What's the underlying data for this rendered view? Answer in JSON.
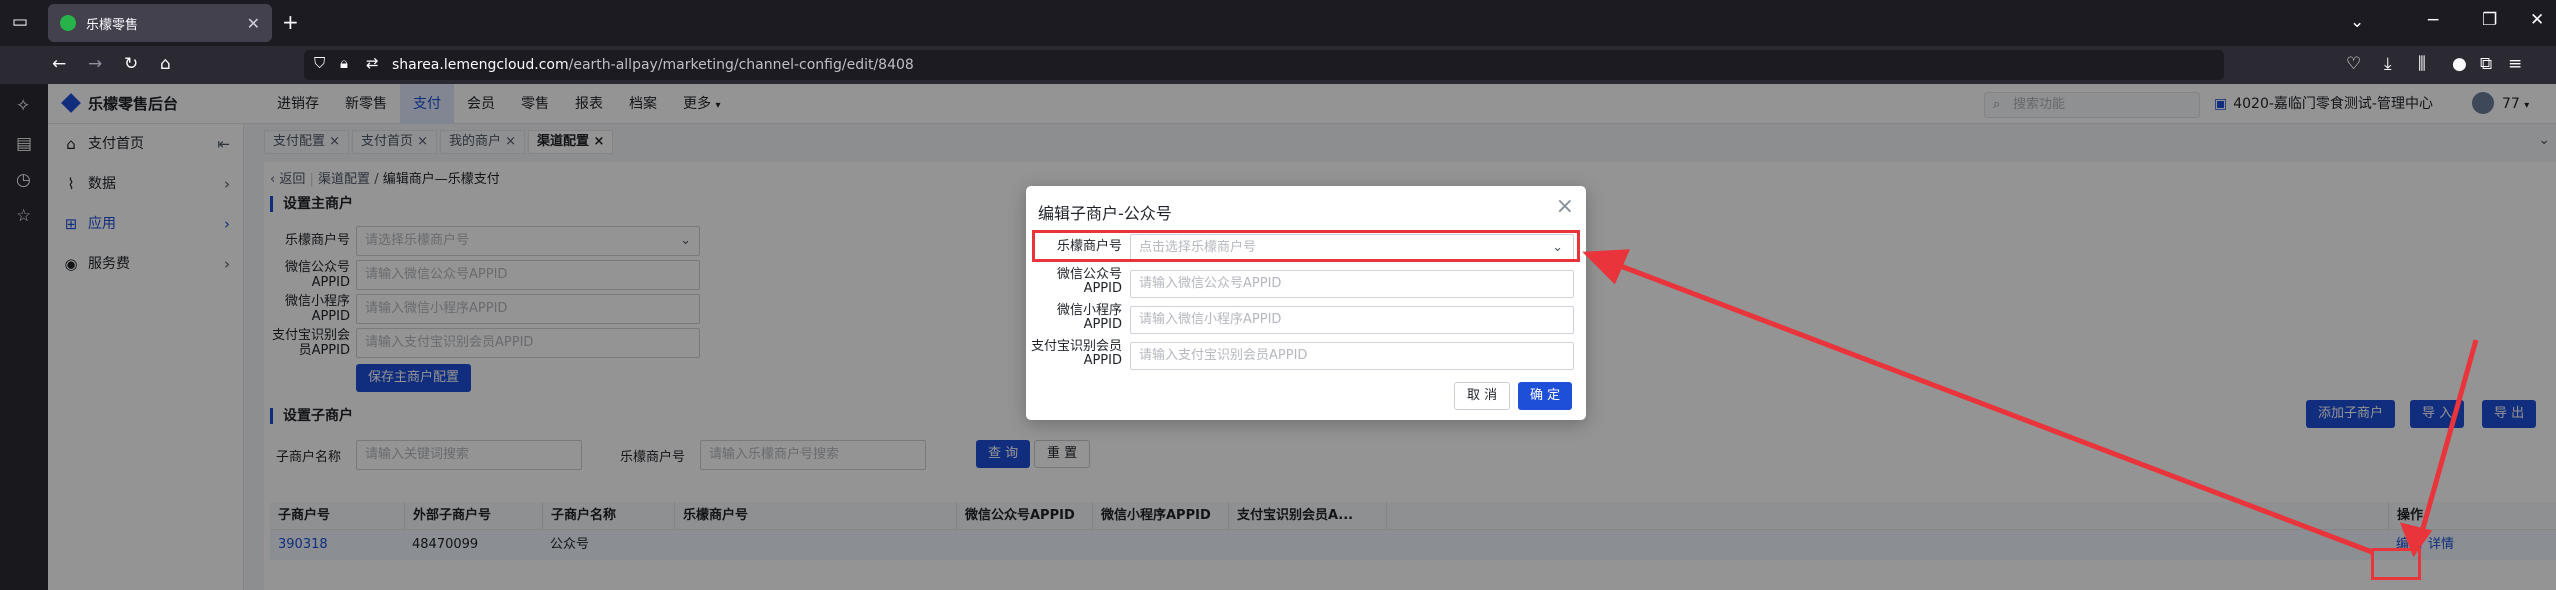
{
  "browser": {
    "tab_title": "乐檬零售",
    "url_host": "sharea.lemengcloud.com",
    "url_path": "/earth-allpay/marketing/channel-config/edit/8408"
  },
  "header": {
    "brand": "乐檬零售后台",
    "nav": [
      "进销存",
      "新零售",
      "支付",
      "会员",
      "零售",
      "报表",
      "档案",
      "更多"
    ],
    "active_nav": "支付",
    "search_placeholder": "搜索功能",
    "store": "4020-嘉临门零食测试-管理中心",
    "user": "77"
  },
  "sidebar": {
    "items": [
      {
        "label": "支付首页",
        "icon": "home-icon"
      },
      {
        "label": "数据",
        "icon": "chart-icon"
      },
      {
        "label": "应用",
        "icon": "apps-icon"
      },
      {
        "label": "服务费",
        "icon": "fee-icon"
      }
    ]
  },
  "page_tabs": [
    "支付配置",
    "支付首页",
    "我的商户",
    "渠道配置"
  ],
  "breadcrumb": {
    "back": "返回",
    "parent": "渠道配置",
    "current": "编辑商户—乐檬支付"
  },
  "main_merchant": {
    "title": "设置主商户",
    "fields": [
      {
        "label": "乐檬商户号",
        "placeholder": "请选择乐檬商户号"
      },
      {
        "label": "微信公众号APPID",
        "placeholder": "请输入微信公众号APPID"
      },
      {
        "label": "微信小程序APPID",
        "placeholder": "请输入微信小程序APPID"
      },
      {
        "label": "支付宝识别会员APPID",
        "placeholder": "请输入支付宝识别会员APPID"
      }
    ],
    "save_button": "保存主商户配置"
  },
  "sub_merchant": {
    "title": "设置子商户",
    "add_button": "添加子商户",
    "import_button": "导 入",
    "export_button": "导 出",
    "filter_name_label": "子商户名称",
    "filter_name_placeholder": "请输入关键词搜索",
    "filter_lemeng_label": "乐檬商户号",
    "filter_lemeng_placeholder": "请输入乐檬商户号搜索",
    "query_button": "查 询",
    "reset_button": "重 置",
    "columns": [
      "子商户号",
      "外部子商户号",
      "子商户名称",
      "乐檬商户号",
      "微信公众号APPID",
      "微信小程序APPID",
      "支付宝识别会员A...",
      "操作"
    ],
    "rows": [
      {
        "id": "390318",
        "external_id": "48470099",
        "name": "公众号",
        "lemeng_id": "",
        "wx_appid": "",
        "mini_appid": "",
        "alipay_appid": "",
        "actions": [
          "编辑",
          "详情"
        ]
      }
    ]
  },
  "modal": {
    "title": "编辑子商户-公众号",
    "fields": [
      {
        "label": "乐檬商户号",
        "placeholder": "点击选择乐檬商户号"
      },
      {
        "label": "微信公众号APPID",
        "placeholder": "请输入微信公众号APPID"
      },
      {
        "label": "微信小程序APPID",
        "placeholder": "请输入微信小程序APPID"
      },
      {
        "label": "支付宝识别会员APPID",
        "placeholder": "请输入支付宝识别会员APPID"
      }
    ],
    "cancel_button": "取 消",
    "ok_button": "确 定"
  },
  "colors": {
    "primary": "#1e4fd8",
    "annotation": "#e8343a"
  }
}
